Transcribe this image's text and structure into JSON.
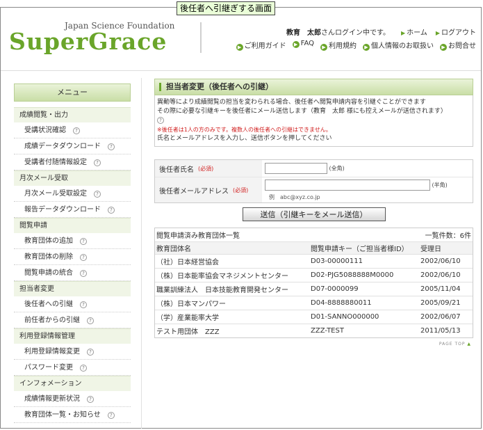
{
  "caption": "後任者へ引継ぎする画面",
  "brand": {
    "sub": "Japan Science Foundation",
    "main": "SuperGrace"
  },
  "header": {
    "greet_name": "教育　太郎",
    "greet_suffix": "さんログイン中です。",
    "top_links": [
      "ホーム",
      "ログアウト"
    ],
    "nav_links": [
      "ご利用ガイド",
      "FAQ",
      "利用規約",
      "個人情報のお取扱い",
      "お問合せ"
    ]
  },
  "sidebar": {
    "title": "メニュー",
    "sections": [
      {
        "title": "成績閲覧・出力",
        "items": [
          "受講状況確認",
          "成績データダウンロード",
          "受講者付随情報設定"
        ]
      },
      {
        "title": "月次メール受取",
        "items": [
          "月次メール受取設定",
          "報告データダウンロード"
        ]
      },
      {
        "title": "閲覧申請",
        "items": [
          "教育団体の追加",
          "教育団体の削除",
          "閲覧申請の統合"
        ]
      },
      {
        "title": "担当者変更",
        "items": [
          "後任者への引継",
          "前任者からの引継"
        ]
      },
      {
        "title": "利用登録情報管理",
        "items": [
          "利用登録情報変更",
          "パスワード変更"
        ]
      },
      {
        "title": "インフォメーション",
        "items": [
          "成績情報更新状況",
          "教育団体一覧・お知らせ"
        ]
      }
    ]
  },
  "main": {
    "heading": "担当者変更（後任者への引継）",
    "desc_line1": "異動等により成績閲覧の担当を変わられる場合、後任者へ閲覧申請内容を引継ぐことができます",
    "desc_line2": "その際に必要な引継キーを後任者にメール送信します（教育　太郎 様にも控えメールが送信されます）",
    "desc_warn": "※後任者は1人の方のみです。複数人の後任者への引継はできません。",
    "desc_line3": "氏名とメールアドレスを入力し、送信ボタンを押してください",
    "form": {
      "name_label": "後任者氏名",
      "email_label": "後任者メールアドレス",
      "required": "(必須)",
      "name_value": "",
      "email_value": "",
      "name_hint": "(全角)",
      "email_hint": "(半角)",
      "email_example": "例　abc@xyz.co.jp"
    },
    "send_label": "送信（引継キーをメール送信）",
    "list": {
      "title": "閲覧申請済み教育団体一覧",
      "count": "一覧件数：6件",
      "headers": [
        "教育団体名",
        "閲覧申請キー（ご担当者様ID）",
        "受理日"
      ],
      "rows": [
        [
          "（社）日本経営協会",
          "D03-00000111",
          "2002/06/10"
        ],
        [
          "（株）日本能率協会マネジメントセンター",
          "D02-PJG5088888M0000",
          "2002/06/10"
        ],
        [
          "職業訓練法人　日本技能教育開発センター",
          "D07-0000099",
          "2005/11/04"
        ],
        [
          "（株）日本マンパワー",
          "D04-8888880011",
          "2005/09/21"
        ],
        [
          "（学）産業能率大学",
          "D01-SANNO000000",
          "2002/06/07"
        ],
        [
          "テスト用団体　ZZZ",
          "ZZZ-TEST",
          "2011/05/13"
        ]
      ]
    },
    "page_top": "PAGE TOP"
  }
}
